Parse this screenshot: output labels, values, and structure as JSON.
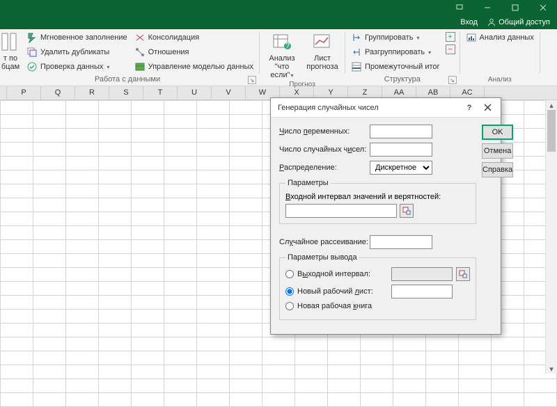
{
  "titlebar": {},
  "header": {
    "login": "Вход",
    "share": "Общий доступ"
  },
  "ribbon": {
    "group1": {
      "col0a": "т по",
      "col0b": "бцам",
      "b1": "Мгновенное заполнение",
      "b2": "Удалить дубликаты",
      "b3": "Проверка данных",
      "b4": "Консолидация",
      "b5": "Отношения",
      "b6": "Управление моделью данных",
      "label": "Работа с данными"
    },
    "group2": {
      "b1a": "Анализ \"что",
      "b1b": "если\"",
      "b2a": "Лист",
      "b2b": "прогноза",
      "label": "Прогноз"
    },
    "group3": {
      "b1": "Группировать",
      "b2": "Разгруппировать",
      "b3": "Промежуточный итог",
      "label": "Структура"
    },
    "group4": {
      "b1": "Анализ данных",
      "label": "Анализ"
    }
  },
  "columns": [
    "P",
    "Q",
    "R",
    "S",
    "T",
    "U",
    "V",
    "W",
    "X",
    "Y",
    "Z",
    "AA",
    "AB",
    "AC"
  ],
  "dialog": {
    "title": "Генерация случайных чисел",
    "ok": "OK",
    "cancel": "Отмена",
    "help": "Справка",
    "f1": "Число переменных:",
    "f2": "Число случайных чисел:",
    "f3": "Распределение:",
    "dist": [
      "Дискретное"
    ],
    "fs1": "Параметры",
    "fs1_lbl": "Входной интервал значений и верятностей:",
    "f4": "Случайное рассеивание:",
    "fs2": "Параметры вывода",
    "r1": "Выходной интервал:",
    "r2": "Новый рабочий лист:",
    "r3": "Новая рабочая книга"
  }
}
